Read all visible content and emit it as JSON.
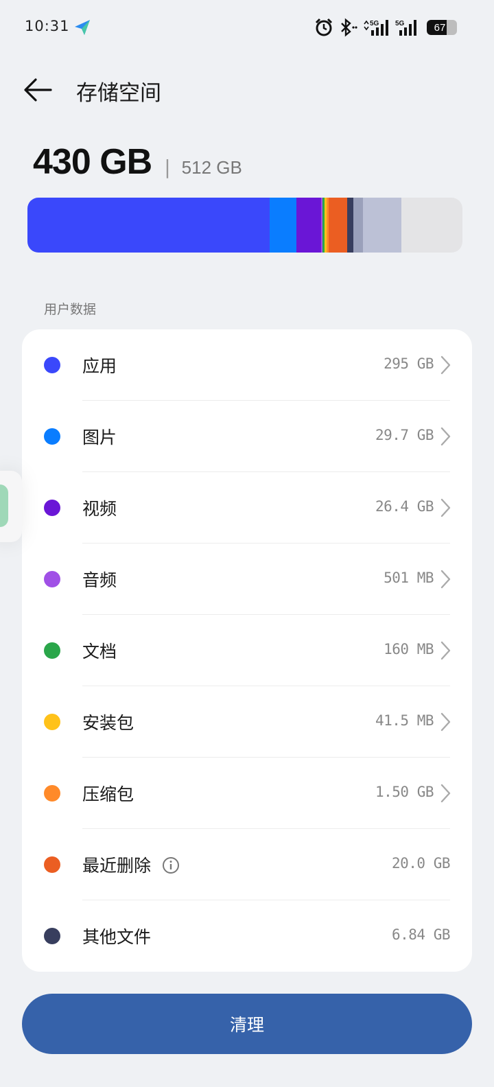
{
  "status_bar": {
    "time": "10:31",
    "battery_level": 67,
    "battery_text": "67",
    "network_labels": [
      "5G",
      "5G"
    ]
  },
  "header": {
    "title": "存储空间"
  },
  "summary": {
    "used": "430 GB",
    "separator": "|",
    "total": "512 GB"
  },
  "usage_bar": {
    "segments": [
      {
        "name": "apps",
        "fraction": 0.556,
        "color": "#3a48fb"
      },
      {
        "name": "pictures",
        "fraction": 0.063,
        "color": "#0a7dff"
      },
      {
        "name": "videos",
        "fraction": 0.056,
        "color": "#6a16d6"
      },
      {
        "name": "audio",
        "fraction": 0.004,
        "color": "#a050e6"
      },
      {
        "name": "docs",
        "fraction": 0.004,
        "color": "#2aa64a"
      },
      {
        "name": "apk",
        "fraction": 0.004,
        "color": "#ffc21a"
      },
      {
        "name": "archives",
        "fraction": 0.006,
        "color": "#ff8a2a"
      },
      {
        "name": "recently-deleted",
        "fraction": 0.042,
        "color": "#eb5e22"
      },
      {
        "name": "other",
        "fraction": 0.014,
        "color": "#383e5e"
      },
      {
        "name": "system-a",
        "fraction": 0.022,
        "color": "#9aa0ba"
      },
      {
        "name": "system-b",
        "fraction": 0.089,
        "color": "#bcc1d6"
      }
    ],
    "track_color": "#e4e4e6"
  },
  "section": {
    "label": "用户数据"
  },
  "items": [
    {
      "label": "应用",
      "value": "295 GB",
      "color": "#3a48fb",
      "chevron": true
    },
    {
      "label": "图片",
      "value": "29.7 GB",
      "color": "#0a7dff",
      "chevron": true
    },
    {
      "label": "视频",
      "value": "26.4 GB",
      "color": "#6a16d6",
      "chevron": true
    },
    {
      "label": "音频",
      "value": "501 MB",
      "color": "#a050e6",
      "chevron": true
    },
    {
      "label": "文档",
      "value": "160 MB",
      "color": "#2aa64a",
      "chevron": true
    },
    {
      "label": "安装包",
      "value": "41.5 MB",
      "color": "#ffc21a",
      "chevron": true
    },
    {
      "label": "压缩包",
      "value": "1.50 GB",
      "color": "#ff8a2a",
      "chevron": true
    },
    {
      "label": "最近删除",
      "value": "20.0 GB",
      "color": "#eb5e22",
      "chevron": false,
      "info": true
    },
    {
      "label": "其他文件",
      "value": "6.84 GB",
      "color": "#383e5e",
      "chevron": false
    }
  ],
  "footer": {
    "clean_label": "清理"
  },
  "icons": {
    "back": "back-arrow-icon",
    "alarm": "alarm-icon",
    "bluetooth": "bluetooth-icon",
    "signal": "signal-icon",
    "chevron": "chevron-right-icon",
    "info": "info-icon"
  }
}
